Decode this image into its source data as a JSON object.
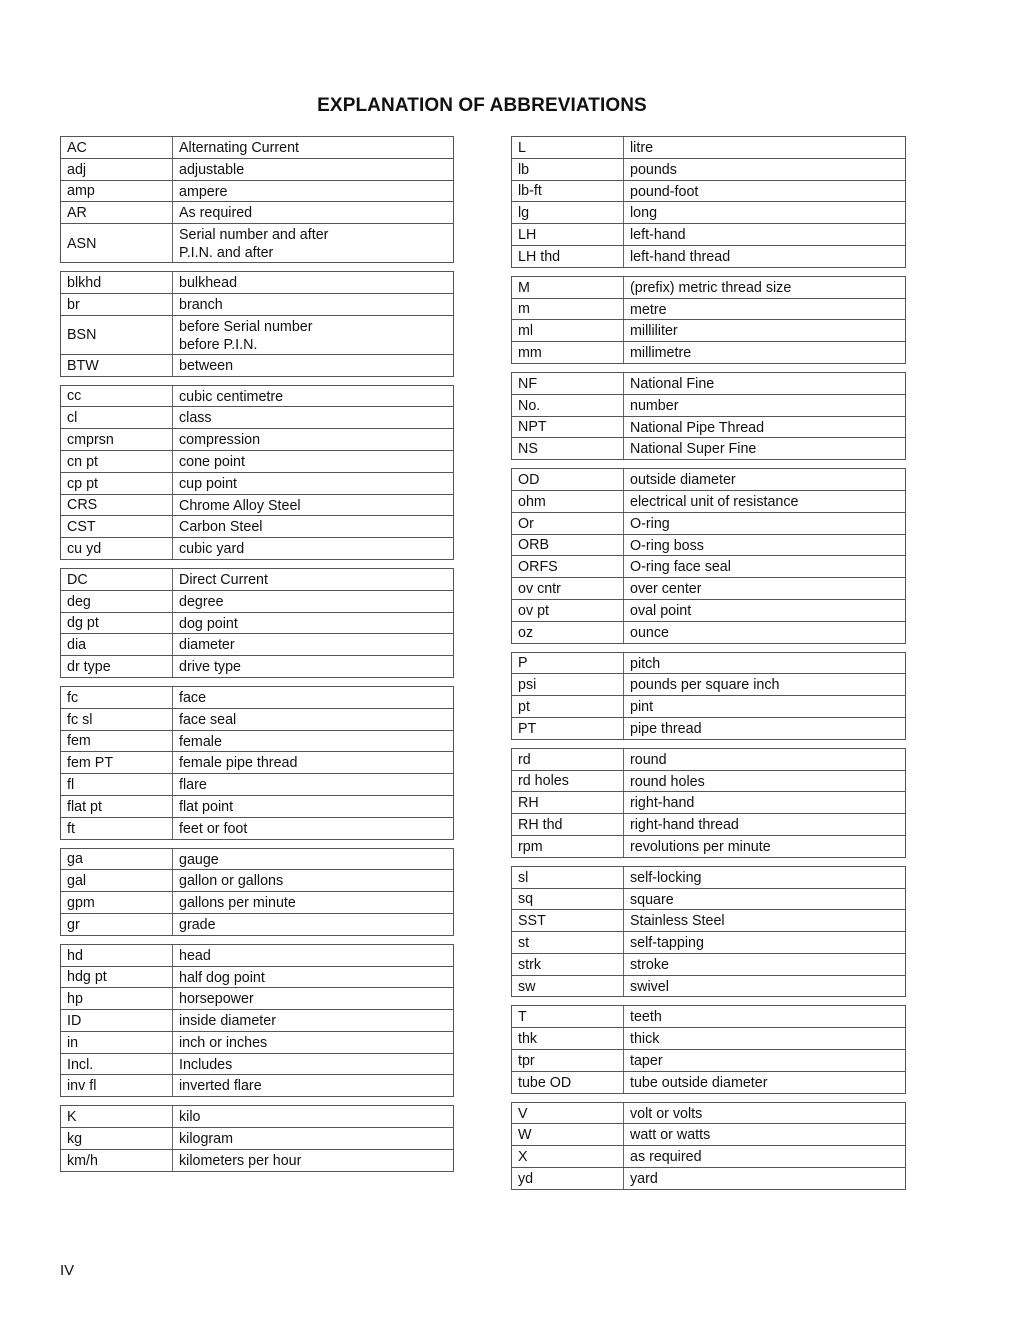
{
  "title": "EXPLANATION OF ABBREVIATIONS",
  "page_number": "IV",
  "left_groups": [
    [
      [
        "AC",
        "Alternating Current"
      ],
      [
        "adj",
        "adjustable"
      ],
      [
        "amp",
        "ampere"
      ],
      [
        "AR",
        "As required"
      ],
      [
        "ASN",
        "Serial number and after\nP.I.N. and after"
      ]
    ],
    [
      [
        "blkhd",
        "bulkhead"
      ],
      [
        "br",
        "branch"
      ],
      [
        "BSN",
        "before Serial number\nbefore P.I.N."
      ],
      [
        "BTW",
        "between"
      ]
    ],
    [
      [
        "cc",
        "cubic centimetre"
      ],
      [
        "cl",
        "class"
      ],
      [
        "cmprsn",
        "compression"
      ],
      [
        "cn pt",
        "cone point"
      ],
      [
        "cp pt",
        "cup point"
      ],
      [
        "CRS",
        "Chrome Alloy Steel"
      ],
      [
        "CST",
        "Carbon Steel"
      ],
      [
        "cu yd",
        "cubic yard"
      ]
    ],
    [
      [
        "DC",
        "Direct Current"
      ],
      [
        "deg",
        "degree"
      ],
      [
        "dg pt",
        "dog point"
      ],
      [
        "dia",
        "diameter"
      ],
      [
        "dr type",
        "drive type"
      ]
    ],
    [
      [
        "fc",
        "face"
      ],
      [
        "fc sl",
        "face seal"
      ],
      [
        "fem",
        "female"
      ],
      [
        "fem PT",
        "female pipe thread"
      ],
      [
        "fl",
        "flare"
      ],
      [
        "flat pt",
        "flat point"
      ],
      [
        "ft",
        "feet or foot"
      ]
    ],
    [
      [
        "ga",
        "gauge"
      ],
      [
        "gal",
        "gallon or gallons"
      ],
      [
        "gpm",
        "gallons per minute"
      ],
      [
        "gr",
        "grade"
      ]
    ],
    [
      [
        "hd",
        "head"
      ],
      [
        "hdg pt",
        "half dog point"
      ],
      [
        "hp",
        "horsepower"
      ],
      [
        "ID",
        "inside diameter"
      ],
      [
        "in",
        "inch or inches"
      ],
      [
        "Incl.",
        "Includes"
      ],
      [
        "inv fl",
        "inverted flare"
      ]
    ],
    [
      [
        "K",
        "kilo"
      ],
      [
        "kg",
        "kilogram"
      ],
      [
        "km/h",
        "kilometers per hour"
      ]
    ]
  ],
  "right_groups": [
    [
      [
        "L",
        "litre"
      ],
      [
        "lb",
        "pounds"
      ],
      [
        "lb-ft",
        "pound-foot"
      ],
      [
        "lg",
        "long"
      ],
      [
        "LH",
        "left-hand"
      ],
      [
        "LH thd",
        "left-hand thread"
      ]
    ],
    [
      [
        "M",
        "(prefix) metric thread size"
      ],
      [
        "m",
        "metre"
      ],
      [
        "ml",
        "milliliter"
      ],
      [
        "mm",
        "millimetre"
      ]
    ],
    [
      [
        "NF",
        "National Fine"
      ],
      [
        "No.",
        "number"
      ],
      [
        "NPT",
        "National Pipe Thread"
      ],
      [
        "NS",
        "National Super Fine"
      ]
    ],
    [
      [
        "OD",
        "outside diameter"
      ],
      [
        "ohm",
        "electrical unit of resistance"
      ],
      [
        "Or",
        "O-ring"
      ],
      [
        "ORB",
        "O-ring boss"
      ],
      [
        "ORFS",
        "O-ring face seal"
      ],
      [
        "ov cntr",
        "over center"
      ],
      [
        "ov pt",
        "oval point"
      ],
      [
        "oz",
        "ounce"
      ]
    ],
    [
      [
        "P",
        "pitch"
      ],
      [
        "psi",
        "pounds per square inch"
      ],
      [
        "pt",
        "pint"
      ],
      [
        "PT",
        "pipe thread"
      ]
    ],
    [
      [
        "rd",
        "round"
      ],
      [
        "rd holes",
        "round holes"
      ],
      [
        "RH",
        "right-hand"
      ],
      [
        "RH thd",
        "right-hand thread"
      ],
      [
        "rpm",
        "revolutions per minute"
      ]
    ],
    [
      [
        "sl",
        "self-locking"
      ],
      [
        "sq",
        "square"
      ],
      [
        "SST",
        "Stainless Steel"
      ],
      [
        "st",
        "self-tapping"
      ],
      [
        "strk",
        "stroke"
      ],
      [
        "sw",
        "swivel"
      ]
    ],
    [
      [
        "T",
        "teeth"
      ],
      [
        "thk",
        "thick"
      ],
      [
        "tpr",
        "taper"
      ],
      [
        "tube OD",
        "tube outside diameter"
      ]
    ],
    [
      [
        "V",
        "volt or volts"
      ],
      [
        "W",
        "watt or watts"
      ],
      [
        "X",
        "as required"
      ],
      [
        "yd",
        "yard"
      ]
    ]
  ]
}
